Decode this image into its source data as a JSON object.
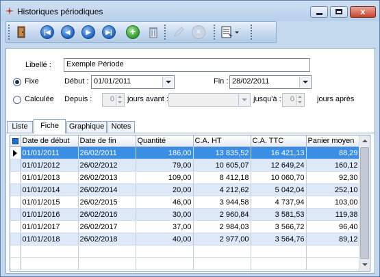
{
  "window": {
    "title": "Historiques périodiques",
    "buttons": {
      "minimize": "minimize",
      "maximize": "maximize",
      "close": "x"
    }
  },
  "toolbar": {
    "icons": [
      "exit-door-icon",
      "first-record-icon",
      "previous-record-icon",
      "next-record-icon",
      "last-record-icon",
      "add-icon",
      "delete-icon",
      "edit-icon",
      "cancel-icon",
      "report-menu-icon"
    ],
    "first_glyph": "|◀",
    "prev_glyph": "◀",
    "next_glyph": "▶",
    "last_glyph": "▶|",
    "add_glyph": "+",
    "cancel_glyph": "×"
  },
  "form": {
    "libelle_label": "Libellé :",
    "libelle_value": "Exemple Période",
    "fixe_label": "Fixe",
    "debut_label": "Début :",
    "debut_value": "01/01/2011",
    "fin_label": "Fin :",
    "fin_value": "28/02/2011",
    "calculee_label": "Calculée",
    "depuis_label": "Depuis :",
    "depuis_value": "0",
    "jours_avant_label": "jours avant :",
    "jusqua_label": "jusqu'à :",
    "jusqua_value": "0",
    "jours_apres_label": "jours après",
    "period_mode": "Fixe"
  },
  "tabs": [
    {
      "label": "Liste"
    },
    {
      "label": "Fiche"
    },
    {
      "label": "Graphique"
    },
    {
      "label": "Notes"
    }
  ],
  "active_tab": "Fiche",
  "grid": {
    "columns": [
      "Date de début",
      "Date de fin",
      "Quantité",
      "C.A. HT",
      "C.A. TTC",
      "Panier moyen"
    ],
    "rows": [
      [
        "01/01/2011",
        "26/02/2011",
        "186,00",
        "13 835,52",
        "16 421,13",
        "88,29"
      ],
      [
        "01/01/2012",
        "26/02/2012",
        "79,00",
        "10 605,07",
        "12 649,24",
        "160,12"
      ],
      [
        "01/01/2013",
        "26/02/2013",
        "109,00",
        "8 412,18",
        "10 060,70",
        "92,30"
      ],
      [
        "01/01/2014",
        "26/02/2014",
        "20,00",
        "4 212,62",
        "5 042,04",
        "252,10"
      ],
      [
        "01/01/2015",
        "26/02/2015",
        "46,00",
        "3 944,58",
        "4 737,94",
        "103,00"
      ],
      [
        "01/01/2016",
        "26/02/2016",
        "30,00",
        "2 960,84",
        "3 581,53",
        "119,38"
      ],
      [
        "01/01/2017",
        "26/02/2017",
        "37,00",
        "2 984,03",
        "3 566,72",
        "96,40"
      ],
      [
        "01/01/2018",
        "26/02/2018",
        "40,00",
        "2 977,00",
        "3 564,76",
        "89,12"
      ]
    ],
    "selected_row": 0
  }
}
